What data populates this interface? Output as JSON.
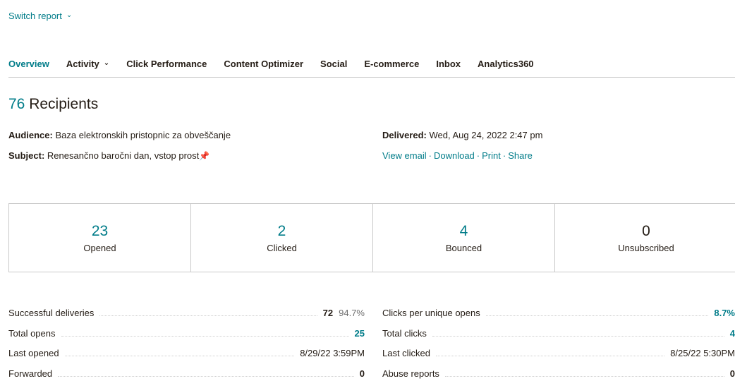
{
  "header": {
    "switch_report": "Switch report"
  },
  "tabs": [
    {
      "label": "Overview",
      "active": true
    },
    {
      "label": "Activity",
      "has_dropdown": true
    },
    {
      "label": "Click Performance"
    },
    {
      "label": "Content Optimizer"
    },
    {
      "label": "Social"
    },
    {
      "label": "E-commerce"
    },
    {
      "label": "Inbox"
    },
    {
      "label": "Analytics360"
    }
  ],
  "recipients": {
    "count": "76",
    "label": "Recipients"
  },
  "meta": {
    "audience_label": "Audience:",
    "audience_value": "Baza elektronskih pristopnic za obveščanje",
    "subject_label": "Subject:",
    "subject_value": "Renesančno baročni dan, vstop prost",
    "delivered_label": "Delivered:",
    "delivered_value": "Wed, Aug 24, 2022 2:47 pm",
    "links": [
      "View email",
      "Download",
      "Print",
      "Share"
    ],
    "link_separator": "·"
  },
  "stats": [
    {
      "value": "23",
      "label": "Opened"
    },
    {
      "value": "2",
      "label": "Clicked"
    },
    {
      "value": "4",
      "label": "Bounced"
    },
    {
      "value": "0",
      "label": "Unsubscribed"
    }
  ],
  "metrics_left": [
    {
      "label": "Successful deliveries",
      "value": "72",
      "pct": "94.7%"
    },
    {
      "label": "Total opens",
      "value": "25"
    },
    {
      "label": "Last opened",
      "value": "8/29/22 3:59PM"
    },
    {
      "label": "Forwarded",
      "value": "0"
    }
  ],
  "metrics_right": [
    {
      "label": "Clicks per unique opens",
      "value": "8.7%"
    },
    {
      "label": "Total clicks",
      "value": "4"
    },
    {
      "label": "Last clicked",
      "value": "8/25/22 5:30PM"
    },
    {
      "label": "Abuse reports",
      "value": "0"
    }
  ],
  "colors": {
    "accent": "#007c89",
    "text": "#241c15",
    "border": "#c9c9c9",
    "pin": "#d33333"
  }
}
